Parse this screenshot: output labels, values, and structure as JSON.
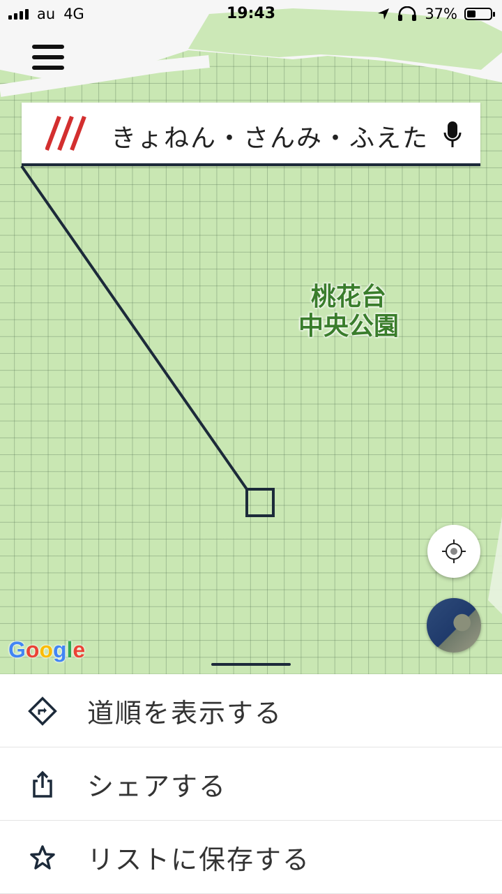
{
  "status_bar": {
    "carrier": "au",
    "network": "4G",
    "time": "19:43",
    "battery_percent_text": "37%",
    "battery_level": 0.37
  },
  "search": {
    "query": "きょねん・さんみ・ふえた",
    "logo_icon": "three-slashes-logo",
    "mic_icon": "microphone-icon"
  },
  "map": {
    "place_label_line1": "桃花台",
    "place_label_line2": "中央公園",
    "attribution": "Google"
  },
  "sheet": {
    "items": [
      {
        "label": "道順を表示する",
        "icon": "directions-icon"
      },
      {
        "label": "シェアする",
        "icon": "share-icon"
      },
      {
        "label": "リストに保存する",
        "icon": "star-icon"
      }
    ]
  },
  "colors": {
    "map_green": "#c9e7b3",
    "park_label": "#3a7d2c",
    "logo_red": "#d32f2f",
    "line_navy": "#1c2a3a"
  }
}
